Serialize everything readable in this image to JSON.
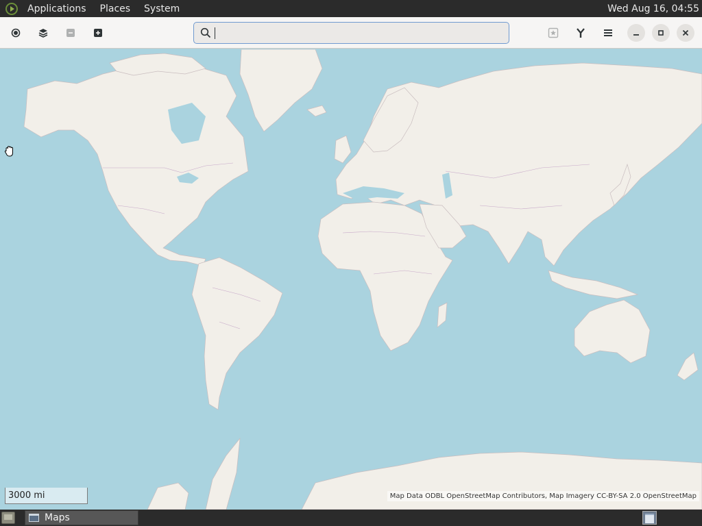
{
  "top_panel": {
    "menus": [
      "Applications",
      "Places",
      "System"
    ],
    "clock": "Wed Aug 16, 04:55"
  },
  "header_bar": {
    "buttons": {
      "location": "locate-icon",
      "layers": "layers-icon",
      "zoom_out": "zoom-out-icon",
      "zoom_in": "zoom-in-icon",
      "favorites": "favorites-icon",
      "route": "route-icon",
      "menu": "hamburger-icon",
      "minimize": "minimize-icon",
      "maximize": "maximize-icon",
      "close": "close-icon"
    },
    "search": {
      "value": "",
      "placeholder": ""
    }
  },
  "map": {
    "scale_label": "3000 mi",
    "attribution": "Map Data ODBL OpenStreetMap Contributors, Map Imagery CC-BY-SA 2.0 OpenStreetMap",
    "colors": {
      "water": "#aad3df",
      "land": "#f2efe9",
      "border": "#c6a7c8"
    }
  },
  "bottom_panel": {
    "task": "Maps"
  }
}
